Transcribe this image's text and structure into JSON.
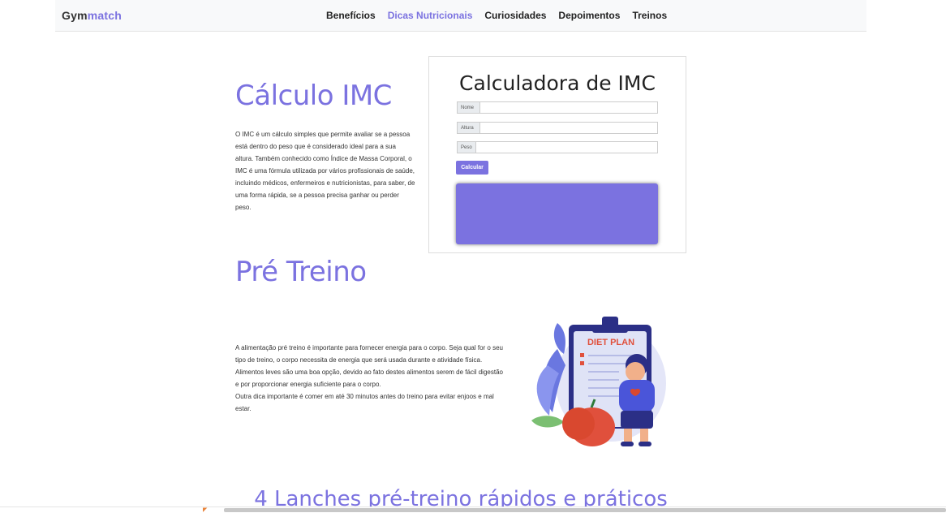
{
  "brand": {
    "part1": "Gym",
    "part2": "match"
  },
  "nav": [
    {
      "label": "Benefícios",
      "active": false
    },
    {
      "label": "Dicas Nutricionais",
      "active": true
    },
    {
      "label": "Curiosidades",
      "active": false
    },
    {
      "label": "Depoimentos",
      "active": false
    },
    {
      "label": "Treinos",
      "active": false
    }
  ],
  "imc": {
    "title": "Cálculo IMC",
    "text": "O IMC é um cálculo simples que permite avaliar se a pessoa está dentro do peso que é considerado ideal para a sua altura. Também conhecido como Índice de Massa Corporal, o IMC é uma fórmula utilizada por vários profissionais de saúde, incluindo médicos, enfermeiros e nutricionistas, para saber, de uma forma rápida, se a pessoa precisa ganhar ou perder peso."
  },
  "calculator": {
    "title": "Calculadora de IMC",
    "fields": [
      {
        "label": "Nome",
        "value": ""
      },
      {
        "label": "Altura",
        "value": ""
      },
      {
        "label": "Peso",
        "value": ""
      }
    ],
    "button": "Calcular",
    "result_color": "#7b72e0"
  },
  "pretreino": {
    "title": "Pré Treino",
    "paragraphs": [
      "A alimentação pré treino é importante para fornecer energia para o corpo. Seja qual for o seu tipo de treino, o corpo necessita de energia que será usada durante e atividade física.",
      "Alimentos leves são uma boa opção, devido ao fato destes alimentos serem de fácil digestão e por proporcionar energia suficiente para o corpo.",
      "Outra dica importante é comer em até 30 minutos antes do treino para evitar enjoos e mal estar."
    ],
    "illustration": {
      "icon": "diet-plan-illustration",
      "board_text": "DIET PLAN"
    }
  },
  "snacks": {
    "title": "4 Lanches pré-treino rápidos e práticos"
  },
  "colors": {
    "accent": "#7b72e0"
  }
}
